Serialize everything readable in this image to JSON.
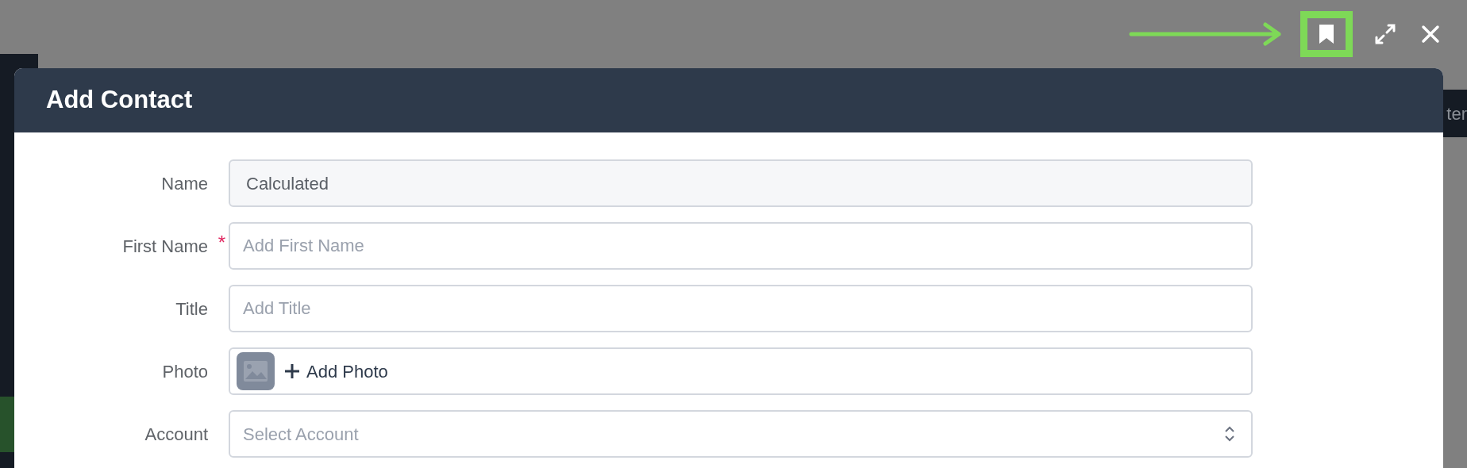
{
  "background": {
    "side_text": "ter"
  },
  "toolbar": [
    {
      "kind": "bookmark",
      "highlighted": true
    },
    {
      "kind": "expand",
      "highlighted": false
    },
    {
      "kind": "close",
      "highlighted": false
    }
  ],
  "modal": {
    "title": "Add Contact",
    "fields": [
      {
        "label": "Name",
        "kind": "readonly",
        "value": "Calculated"
      },
      {
        "label": "First Name",
        "kind": "text",
        "placeholder": "Add First Name",
        "required_mark": "*"
      },
      {
        "label": "Title",
        "kind": "text",
        "placeholder": "Add Title"
      },
      {
        "label": "Photo",
        "kind": "photo",
        "button_label": "Add Photo"
      },
      {
        "label": "Account",
        "kind": "select",
        "placeholder": "Select Account"
      }
    ]
  }
}
